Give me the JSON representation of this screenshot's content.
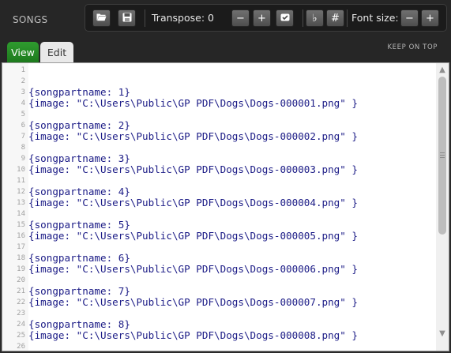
{
  "header": {
    "title": "SONGS",
    "keep_on_top": "KEEP ON TOP"
  },
  "toolbar": {
    "open_icon": "folder-open-icon",
    "save_icon": "save-floppy-icon",
    "transpose_label": "Transpose: 0",
    "minus_glyph": "−",
    "plus_glyph": "+",
    "checkbox_icon": "checkbox-icon",
    "flat_glyph": "♭",
    "sharp_glyph": "#",
    "font_size_label": "Font size:",
    "font_minus_glyph": "−",
    "font_plus_glyph": "+"
  },
  "tabs": [
    {
      "label": "View",
      "active": true,
      "color": "#2a8f2a"
    },
    {
      "label": "Edit",
      "active": false
    }
  ],
  "editor": {
    "lines": [
      {
        "n": "1",
        "text": ""
      },
      {
        "n": "2",
        "text": ""
      },
      {
        "n": "3",
        "text": "{songpartname: 1}"
      },
      {
        "n": "4",
        "text": "{image: \"C:\\Users\\Public\\GP PDF\\Dogs\\Dogs-000001.png\" }"
      },
      {
        "n": "5",
        "text": ""
      },
      {
        "n": "6",
        "text": "{songpartname: 2}"
      },
      {
        "n": "7",
        "text": "{image: \"C:\\Users\\Public\\GP PDF\\Dogs\\Dogs-000002.png\" }"
      },
      {
        "n": "8",
        "text": ""
      },
      {
        "n": "9",
        "text": "{songpartname: 3}"
      },
      {
        "n": "10",
        "text": "{image: \"C:\\Users\\Public\\GP PDF\\Dogs\\Dogs-000003.png\" }"
      },
      {
        "n": "11",
        "text": ""
      },
      {
        "n": "12",
        "text": "{songpartname: 4}"
      },
      {
        "n": "13",
        "text": "{image: \"C:\\Users\\Public\\GP PDF\\Dogs\\Dogs-000004.png\" }"
      },
      {
        "n": "14",
        "text": ""
      },
      {
        "n": "15",
        "text": "{songpartname: 5}"
      },
      {
        "n": "16",
        "text": "{image: \"C:\\Users\\Public\\GP PDF\\Dogs\\Dogs-000005.png\" }"
      },
      {
        "n": "17",
        "text": ""
      },
      {
        "n": "18",
        "text": "{songpartname: 6}"
      },
      {
        "n": "19",
        "text": "{image: \"C:\\Users\\Public\\GP PDF\\Dogs\\Dogs-000006.png\" }"
      },
      {
        "n": "20",
        "text": ""
      },
      {
        "n": "21",
        "text": "{songpartname: 7}"
      },
      {
        "n": "22",
        "text": "{image: \"C:\\Users\\Public\\GP PDF\\Dogs\\Dogs-000007.png\" }"
      },
      {
        "n": "23",
        "text": ""
      },
      {
        "n": "24",
        "text": "{songpartname: 8}"
      },
      {
        "n": "25",
        "text": "{image: \"C:\\Users\\Public\\GP PDF\\Dogs\\Dogs-000008.png\" }"
      },
      {
        "n": "26",
        "text": ""
      }
    ],
    "text_color": "#1b1b86"
  },
  "scrollbar": {
    "up_icon": "scroll-up-icon",
    "down_icon": "scroll-down-icon"
  }
}
